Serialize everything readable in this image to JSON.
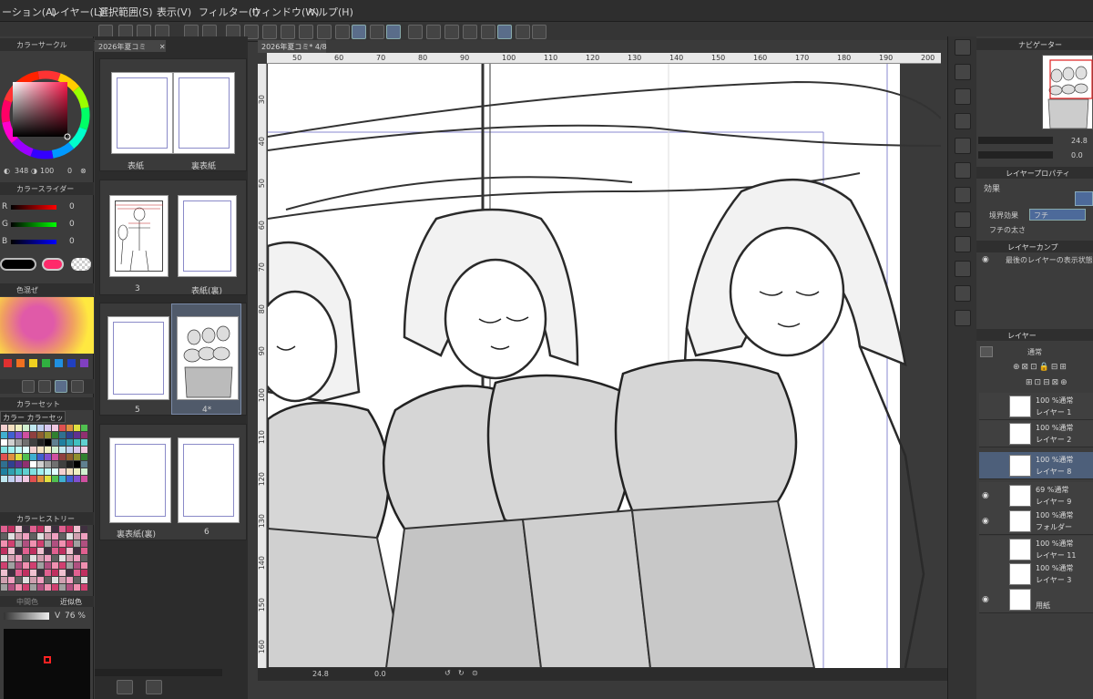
{
  "menu": [
    "ーション(A)",
    "レイヤー(L)",
    "選択範囲(S)",
    "表示(V)",
    "フィルター(I)",
    "ウィンドウ(W)",
    "ヘルプ(H)"
  ],
  "left": {
    "color_circle_title": "カラーサークル",
    "hsv": {
      "h": "348",
      "s": "100",
      "v": "0"
    },
    "color_slider_title": "カラースライダー",
    "rgb": [
      {
        "label": "R",
        "value": "0"
      },
      {
        "label": "G",
        "value": "0"
      },
      {
        "label": "B",
        "value": "0"
      }
    ],
    "mix_title": "色混ぜ",
    "color_set_title": "カラーセット",
    "color_set_name": "カラー カラーセット ver",
    "history_title": "カラーヒストリー",
    "intermediate_title": "中間色",
    "approx_title": "近似色",
    "v_label": "V",
    "v_value": "76 %"
  },
  "pages": {
    "tab": "2026年夏コミ",
    "labels": [
      "表紙",
      "裏表紙",
      "3",
      "表紙(裏)",
      "5",
      "4*",
      "裏表紙(裏)",
      "6"
    ]
  },
  "canvas": {
    "doc_tab": "2026年夏コミ* 4/8",
    "ruler_top": [
      "50",
      "60",
      "70",
      "80",
      "90",
      "100",
      "110",
      "120",
      "130",
      "140",
      "150",
      "160",
      "170",
      "180",
      "190",
      "200"
    ],
    "ruler_left": [
      "30",
      "40",
      "50",
      "60",
      "70",
      "80",
      "90",
      "100",
      "110",
      "120",
      "130",
      "140",
      "150",
      "160"
    ],
    "zoom": "24.8",
    "rotation": "0.0"
  },
  "right": {
    "navigator_title": "ナビゲーター",
    "nav_zoom": "24.8",
    "nav_rot": "0.0",
    "prop_title": "レイヤープロパティ",
    "effect_label": "効果",
    "border_effect_label": "境界効果",
    "border_effect_value": "フチ",
    "border_width_label": "フチの太さ",
    "layer_comp_title": "レイヤーカンプ",
    "layer_comp_item": "最後のレイヤーの表示状態",
    "layer_title": "レイヤー",
    "blend_mode": "通常",
    "layers": [
      {
        "opacity": "100 %通常",
        "name": "レイヤー 1",
        "visible": false,
        "selected": false
      },
      {
        "opacity": "100 %通常",
        "name": "レイヤー 2",
        "visible": false,
        "selected": false
      },
      {
        "opacity": "100 %通常",
        "name": "レイヤー 8",
        "visible": false,
        "selected": true
      },
      {
        "opacity": "69 %通常",
        "name": "レイヤー 9",
        "visible": true,
        "selected": false
      },
      {
        "opacity": "100 %通常",
        "name": "フォルダー",
        "visible": true,
        "selected": false
      },
      {
        "opacity": "100 %通常",
        "name": "レイヤー 11",
        "visible": false,
        "selected": false
      },
      {
        "opacity": "100 %通常",
        "name": "レイヤー 3",
        "visible": false,
        "selected": false
      },
      {
        "opacity": "",
        "name": "用紙",
        "visible": true,
        "selected": false
      }
    ]
  },
  "colors": {
    "main_color": "#ff2a6a",
    "sub_color": "#000000",
    "accent": "#5a78a8"
  }
}
